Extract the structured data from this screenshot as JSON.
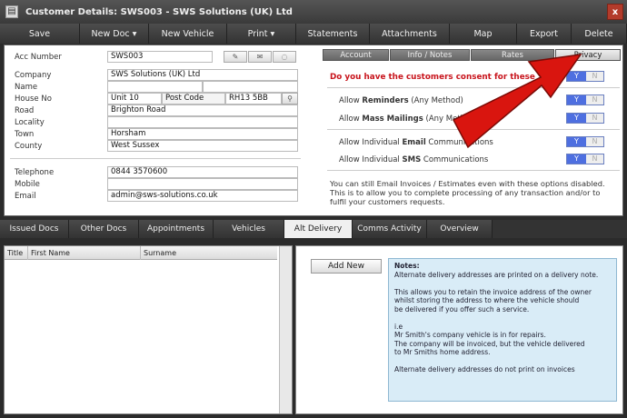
{
  "window": {
    "title": "Customer Details: SWS003 - SWS Solutions (UK) Ltd",
    "close_glyph": "x"
  },
  "toolbar": [
    "Save",
    "New Doc ▾",
    "New Vehicle",
    "Print ▾",
    "Statements",
    "Attachments",
    "Map",
    "Export",
    "Delete"
  ],
  "form": {
    "acc_number": {
      "label": "Acc Number",
      "value": "SWS003"
    },
    "company": {
      "label": "Company",
      "value": "SWS Solutions (UK) Ltd"
    },
    "name": {
      "label": "Name",
      "value": ""
    },
    "house_no": {
      "label": "House No",
      "value": "Unit 10"
    },
    "post_code": {
      "label": "Post Code",
      "value": "RH13 5BB"
    },
    "road": {
      "label": "Road",
      "value": "Brighton Road"
    },
    "locality": {
      "label": "Locality",
      "value": ""
    },
    "town": {
      "label": "Town",
      "value": "Horsham"
    },
    "county": {
      "label": "County",
      "value": "West Sussex"
    },
    "telephone": {
      "label": "Telephone",
      "value": "0844 3570600"
    },
    "mobile": {
      "label": "Mobile",
      "value": ""
    },
    "email": {
      "label": "Email",
      "value": "admin@sws-solutions.co.uk"
    }
  },
  "panel_tabs": [
    "Account",
    "Info / Notes",
    "Rates",
    "Privacy"
  ],
  "privacy": {
    "consent_question": "Do you have the customers consent for these",
    "rows": [
      {
        "pre": "Allow ",
        "bold": "Reminders",
        "post": " (Any Method)"
      },
      {
        "pre": "Allow ",
        "bold": "Mass Mailings",
        "post": " (Any Method)"
      },
      {
        "pre": "Allow Individual ",
        "bold": "Email",
        "post": " Communications"
      },
      {
        "pre": "Allow Individual ",
        "bold": "SMS",
        "post": " Communications"
      }
    ],
    "toggle_yes": "Y",
    "toggle_no": "N",
    "footnote": "You can still Email Invoices / Estimates even with these options disabled. This is to allow you to complete processing of any transaction and/or to fulfil your customers requests."
  },
  "lower_tabs": [
    "Issued Docs",
    "Other Docs",
    "Appointments",
    "Vehicles",
    "Alt Delivery",
    "Comms Activity",
    "Overview"
  ],
  "grid": {
    "columns": [
      "Title",
      "First Name",
      "Surname"
    ]
  },
  "alt_delivery": {
    "add_button": "Add New",
    "notes": [
      "Notes:",
      "Alternate delivery addresses are printed on a delivery note.",
      "",
      "This allows you to retain the invoice address of the owner",
      "whilst storing the address to where the vehicle should",
      "be delivered if you offer such a service.",
      "",
      "i.e",
      "Mr Smith's company vehicle is in for repairs.",
      "The company will be invoiced, but the vehicle delivered",
      "to Mr Smiths home address.",
      "",
      "Alternate delivery addresses do not print on invoices"
    ]
  },
  "colors": {
    "accent_arrow": "#d9150f",
    "toggle_yes": "#4e6fe0",
    "consent_text": "#c8141c"
  },
  "icons": [
    "edit-icon",
    "envelope-icon",
    "speech-bubble-icon",
    "search-icon"
  ]
}
